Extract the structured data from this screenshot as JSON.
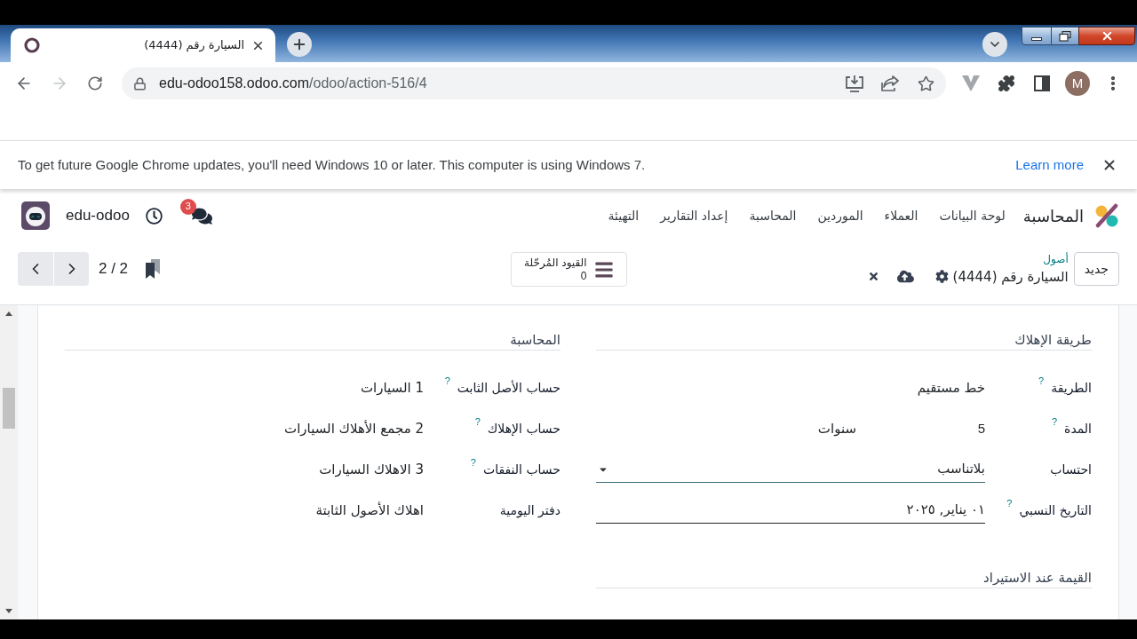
{
  "browser": {
    "tab_title": "السيارة رقم (4444)",
    "url_host": "edu-odoo158.odoo.com",
    "url_path": "/odoo/action-516/4",
    "profile_initial": "M"
  },
  "infobar": {
    "message": "To get future Google Chrome updates, you'll need Windows 10 or later. This computer is using Windows 7.",
    "link": "Learn more"
  },
  "navbar": {
    "app_name": "المحاسبة",
    "menu": [
      "لوحة البيانات",
      "العملاء",
      "الموردين",
      "المحاسبة",
      "إعداد التقارير",
      "التهيئة"
    ],
    "company": "edu-odoo",
    "messages_badge": "3"
  },
  "control_panel": {
    "new_button": "جديد",
    "breadcrumb": "أصول",
    "record_title": "السيارة رقم (4444)",
    "smart_button": {
      "label": "القيود المُرحّلة",
      "count": "0"
    },
    "pager": "2 / 2"
  },
  "form": {
    "columns": [
      {
        "groups": [
          {
            "title": "طريقة الإهلاك",
            "fields": [
              {
                "label": "الطريقة",
                "help": "?",
                "kind": "text",
                "value": "خط مستقيم"
              },
              {
                "label": "المدة",
                "help": "?",
                "kind": "duration",
                "value": "5",
                "unit": "سنوات"
              },
              {
                "label": "احتساب",
                "kind": "select",
                "value": "بلاتناسب"
              },
              {
                "label": "التاريخ النسبي",
                "help": "?",
                "kind": "date",
                "value": "٠١ يناير, ٢٠٢٥"
              }
            ]
          },
          {
            "title": "القيمة عند الاستيراد"
          }
        ]
      },
      {
        "groups": [
          {
            "title": "المحاسبة",
            "fields": [
              {
                "label": "حساب الأصل الثابت",
                "help": "?",
                "kind": "text",
                "value": "1 السيارات"
              },
              {
                "label": "حساب الإهلاك",
                "help": "?",
                "kind": "text",
                "value": "2 مجمع الأهلاك السيارات"
              },
              {
                "label": "حساب النفقات",
                "help": "?",
                "kind": "text",
                "value": "3 الاهلاك السيارات"
              },
              {
                "label": "دفتر اليومية",
                "kind": "text",
                "value": "اهلاك الأصول الثابتة"
              }
            ]
          }
        ]
      }
    ]
  }
}
